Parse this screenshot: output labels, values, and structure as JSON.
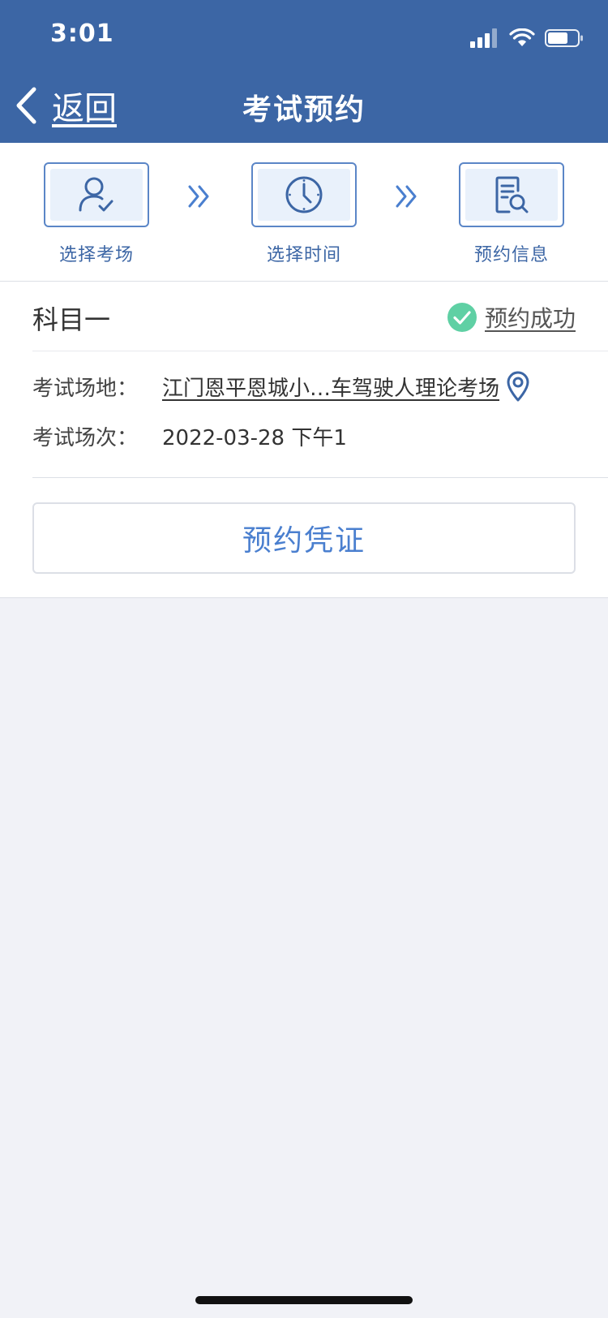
{
  "status_bar": {
    "time": "3:01"
  },
  "nav": {
    "back_label": "返回",
    "title": "考试预约"
  },
  "steps": [
    {
      "label": "选择考场",
      "icon": "user-check-icon"
    },
    {
      "label": "选择时间",
      "icon": "clock-icon"
    },
    {
      "label": "预约信息",
      "icon": "document-search-icon"
    }
  ],
  "appointment": {
    "subject": "科目一",
    "status": "预约成功",
    "venue_label": "考试场地：",
    "venue_value": "江门恩平恩城小…车驾驶人理论考场",
    "session_label": "考试场次：",
    "session_value": "2022-03-28 下午1",
    "voucher_button": "预约凭证"
  },
  "colors": {
    "header": "#3c66a5",
    "accent": "#4a7fcf",
    "success": "#5fd0a4",
    "background": "#f1f2f7"
  }
}
